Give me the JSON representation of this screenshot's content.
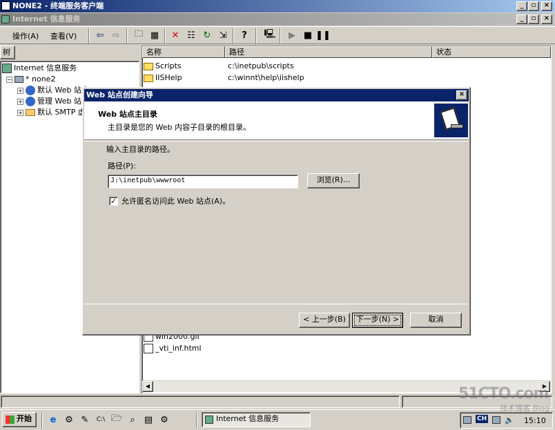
{
  "outer_window": {
    "title": "NONE2 - 终端服务客户端"
  },
  "mmc_window": {
    "title": "Internet 信息服务"
  },
  "menu": {
    "action": "操作(A)",
    "view": "查看(V)"
  },
  "left_pane": {
    "header": "树",
    "root": "Internet 信息服务",
    "server": "* none2",
    "items": [
      "默认 Web 站点",
      "管理 Web 站点",
      "默认 SMTP 虚拟服务器"
    ]
  },
  "right_pane": {
    "columns": [
      "名称",
      "路径",
      "状态"
    ],
    "rows": [
      {
        "name": "Scripts",
        "path": "c:\\inetpub\\scripts"
      },
      {
        "name": "IISHelp",
        "path": "c:\\winnt\\help\\iishelp"
      }
    ],
    "bottom_rows": [
      "win2000.gif",
      "_vti_inf.html"
    ]
  },
  "dialog": {
    "title": "Web 站点创建向导",
    "heading": "Web 站点主目录",
    "subheading": "主目录是您的 Web 内容子目录的根目录。",
    "prompt": "输入主目录的路径。",
    "path_label": "路径(P):",
    "path_value": "J:\\inetpub\\wwwroot",
    "browse": "浏览(R)...",
    "anon_checkbox": "允许匿名访问此 Web 站点(A)。",
    "anon_checked": true,
    "back": "< 上一步(B)",
    "next": "下一步(N) >",
    "cancel": "取消"
  },
  "taskbar": {
    "start": "开始",
    "task": "Internet 信息服务",
    "lang": "CH",
    "time": "15:10"
  },
  "watermark": {
    "site": "51CTO.com",
    "blog": "技术博客 Blog"
  },
  "colors": {
    "titlebar_active": "#0a246a",
    "face": "#d4d0c8"
  }
}
